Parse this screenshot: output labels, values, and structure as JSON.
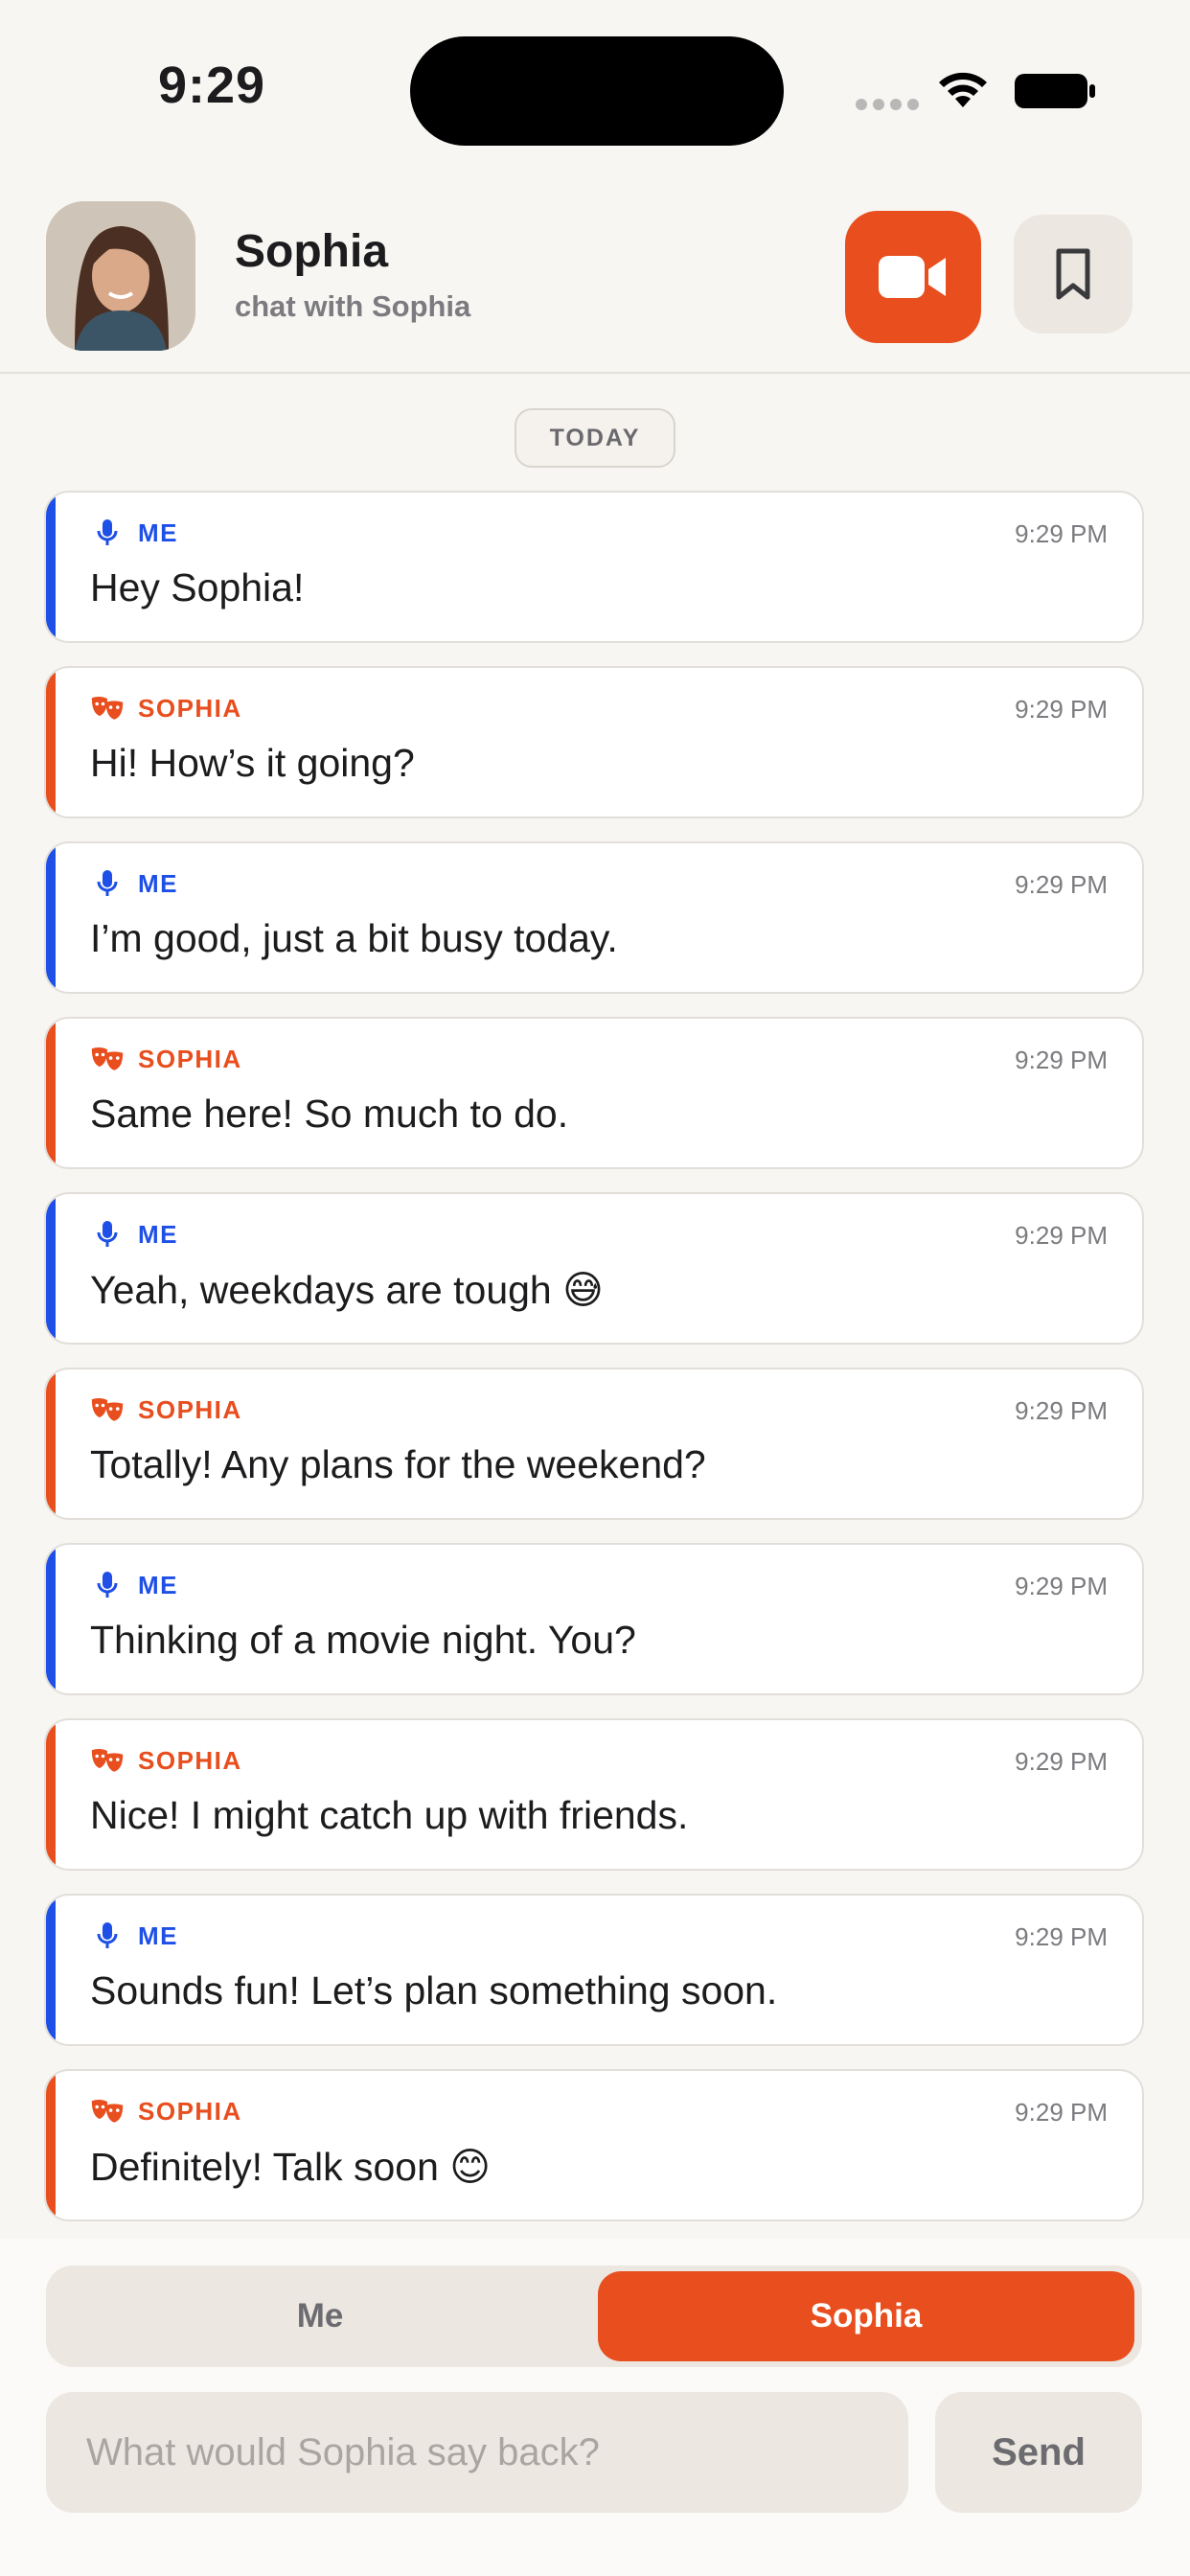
{
  "status_bar": {
    "time": "9:29"
  },
  "header": {
    "name": "Sophia",
    "subtitle": "chat with Sophia",
    "accent": "#e84e1e"
  },
  "date_chip": "TODAY",
  "messages": [
    {
      "sender": "ME",
      "role": "me",
      "time": "9:29 PM",
      "text": "Hey Sophia!"
    },
    {
      "sender": "SOPHIA",
      "role": "them",
      "time": "9:29 PM",
      "text": "Hi! How’s it going?"
    },
    {
      "sender": "ME",
      "role": "me",
      "time": "9:29 PM",
      "text": "I’m good, just a bit busy today."
    },
    {
      "sender": "SOPHIA",
      "role": "them",
      "time": "9:29 PM",
      "text": "Same here! So much to do."
    },
    {
      "sender": "ME",
      "role": "me",
      "time": "9:29 PM",
      "text": "Yeah, weekdays are tough 😅"
    },
    {
      "sender": "SOPHIA",
      "role": "them",
      "time": "9:29 PM",
      "text": "Totally! Any plans for the weekend?"
    },
    {
      "sender": "ME",
      "role": "me",
      "time": "9:29 PM",
      "text": "Thinking of a movie night. You?"
    },
    {
      "sender": "SOPHIA",
      "role": "them",
      "time": "9:29 PM",
      "text": "Nice! I might catch up with friends."
    },
    {
      "sender": "ME",
      "role": "me",
      "time": "9:29 PM",
      "text": "Sounds fun! Let’s plan something soon."
    },
    {
      "sender": "SOPHIA",
      "role": "them",
      "time": "9:29 PM",
      "text": "Definitely! Talk soon 😊"
    }
  ],
  "composer": {
    "toggle_me": "Me",
    "toggle_sophia": "Sophia",
    "selected": "Sophia",
    "placeholder": "What would Sophia say back?",
    "send_label": "Send"
  },
  "colors": {
    "me": "#1e4fe6",
    "sophia": "#e84e1e"
  },
  "icons": {
    "me": "microphone-icon",
    "sophia": "theater-masks-icon",
    "video": "video-camera-icon",
    "bookmark": "bookmark-icon"
  }
}
